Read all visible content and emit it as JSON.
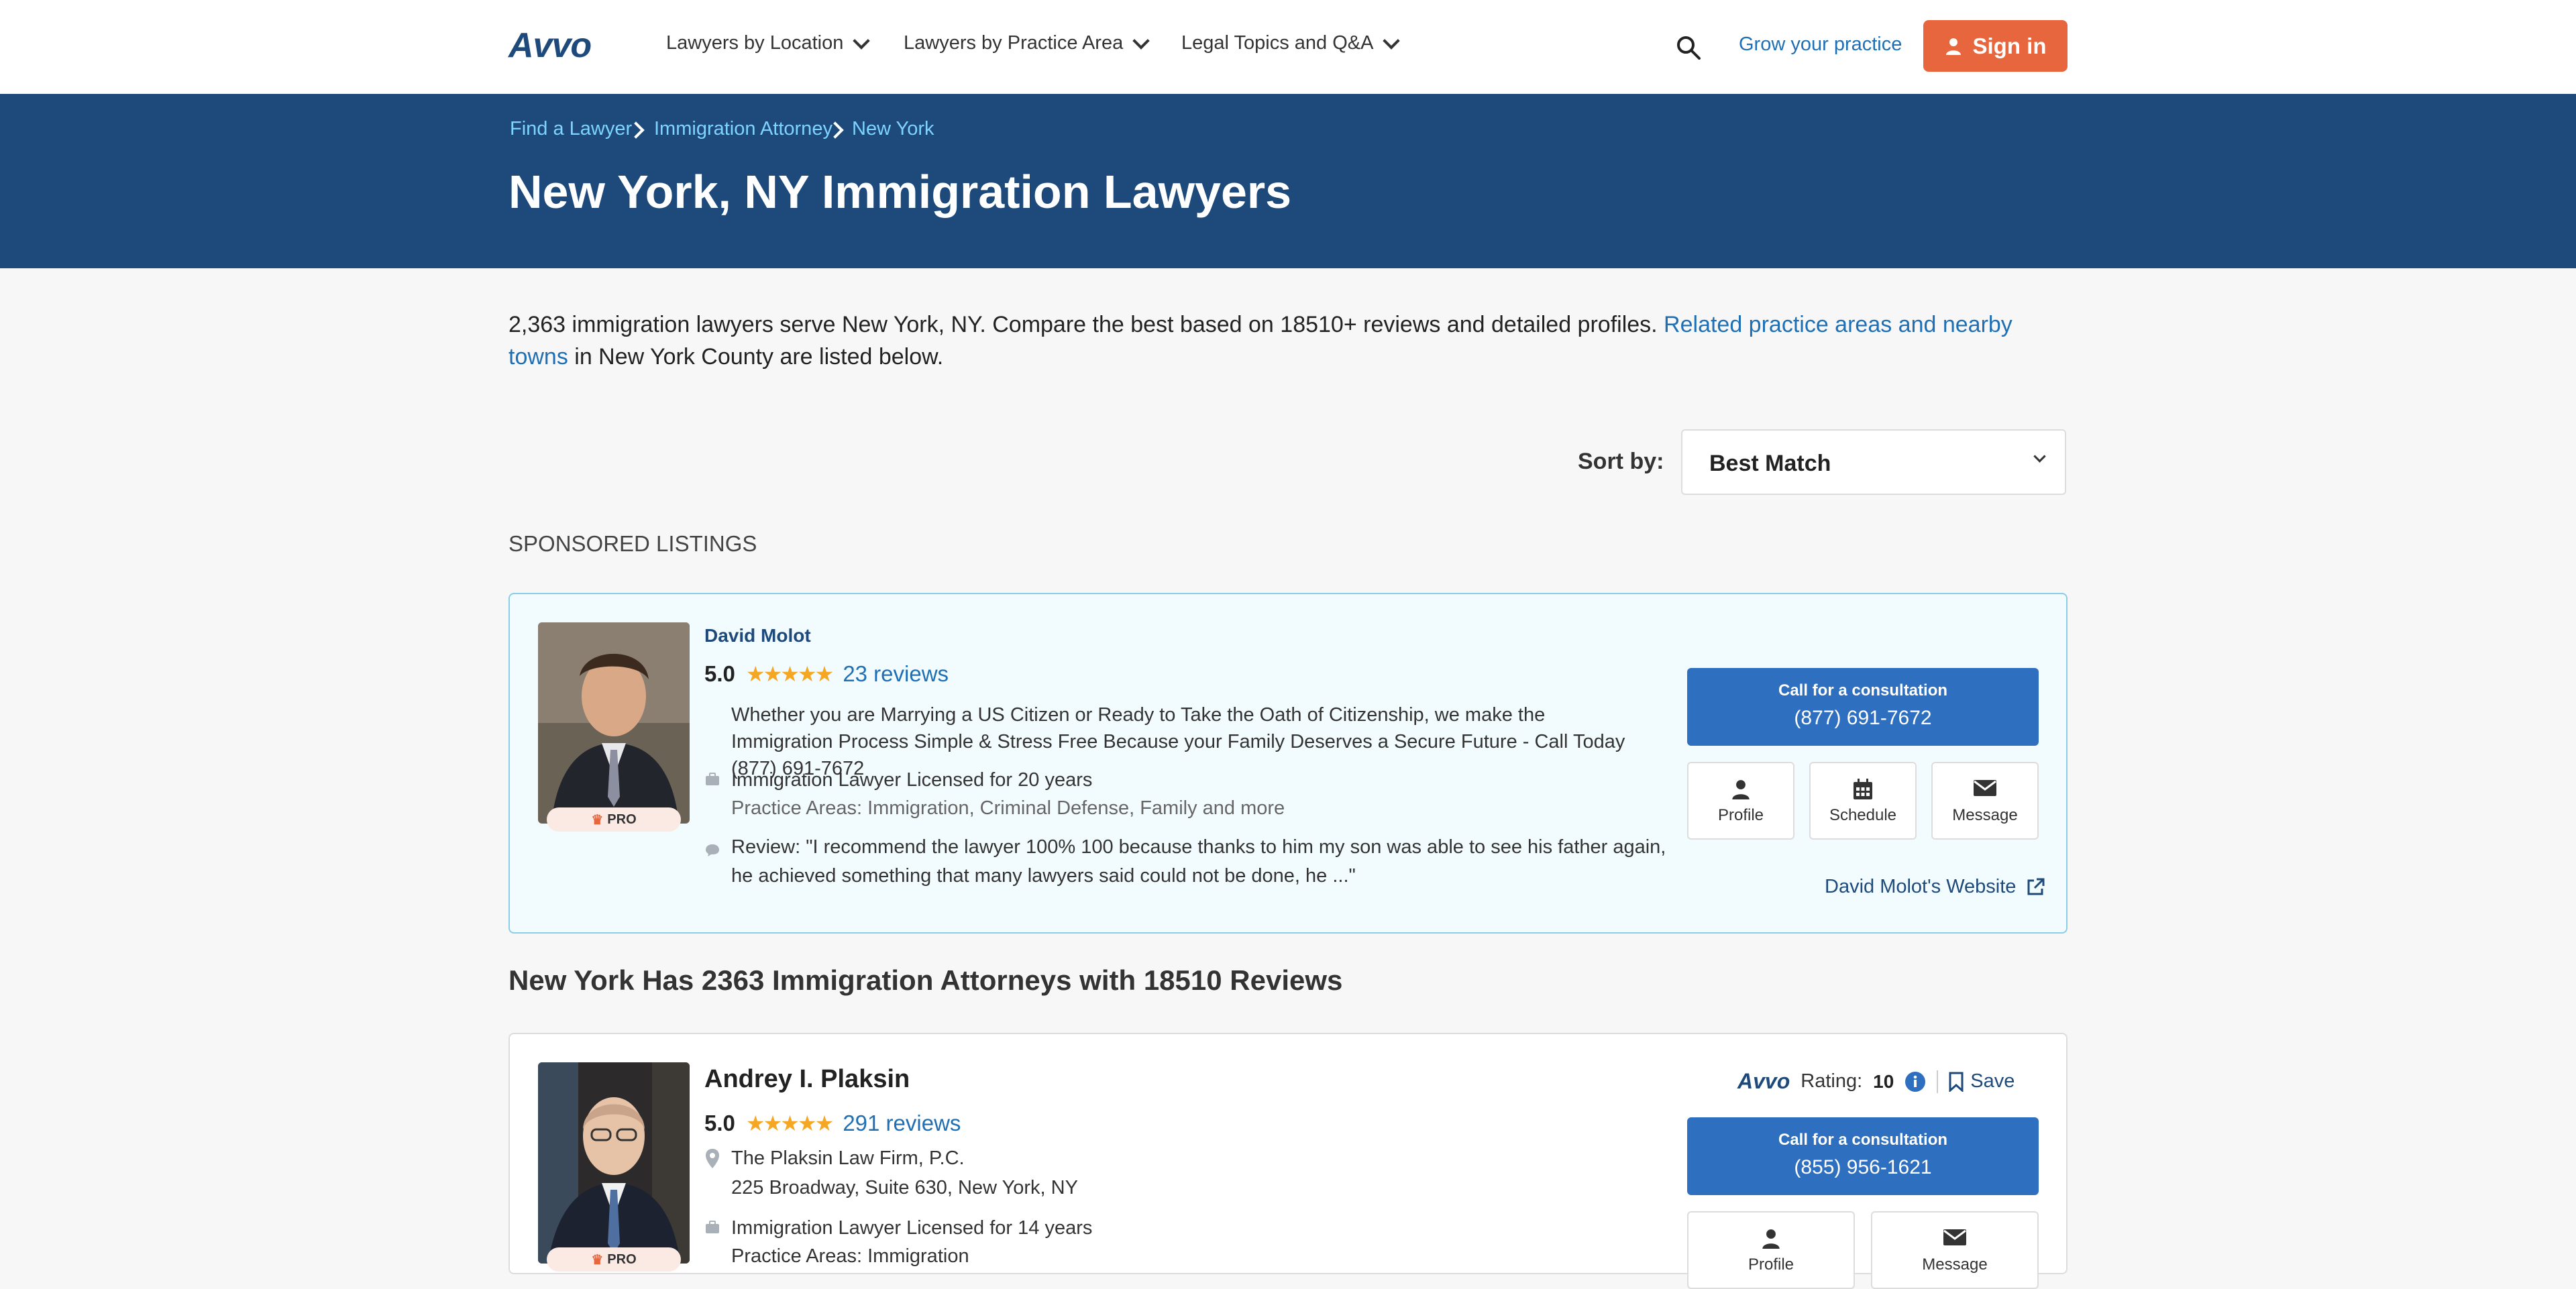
{
  "header": {
    "logo": "Avvo",
    "nav": [
      {
        "label": "Lawyers by Location"
      },
      {
        "label": "Lawyers by Practice Area"
      },
      {
        "label": "Legal Topics and Q&A"
      }
    ],
    "grow_label": "Grow your practice",
    "signin_label": "Sign in"
  },
  "breadcrumb": [
    "Find a Lawyer",
    "Immigration Attorney",
    "New York"
  ],
  "page_title": "New York, NY Immigration Lawyers",
  "intro": {
    "text_before": "2,363 immigration lawyers serve New York, NY. Compare the best based on 18510+ reviews and detailed profiles. ",
    "link": "Related practice areas and nearby towns",
    "text_after": " in New York County are listed below."
  },
  "sort": {
    "label": "Sort by:",
    "value": "Best Match"
  },
  "sponsored_heading": "SPONSORED LISTINGS",
  "sponsored_listing": {
    "name": "David Molot",
    "badge": "PRO",
    "score": "5.0",
    "stars": "★★★★★",
    "reviews": "23 reviews",
    "blurb": "Whether you are Marrying a US Citizen or Ready to Take the Oath of Citizenship, we make the Immigration Process Simple & Stress Free Because your Family Deserves a Secure Future - Call Today (877) 691-7672",
    "licensed": "Immigration Lawyer Licensed for 20 years",
    "practice_areas": "Practice Areas: Immigration, Criminal Defense, Family and more",
    "review": "Review: \"I recommend the lawyer 100% 100 because thanks to him my son was able to see his father again, he achieved something that many lawyers said could not be done, he ...\"",
    "call_label": "Call for a consultation",
    "phone": "(877) 691-7672",
    "buttons": [
      "Profile",
      "Schedule",
      "Message"
    ],
    "website": "David Molot's Website"
  },
  "results_heading": "New York Has 2363 Immigration Attorneys with 18510 Reviews",
  "listing": {
    "name": "Andrey I. Plaksin",
    "badge": "PRO",
    "score": "5.0",
    "stars": "★★★★★",
    "reviews": "291 reviews",
    "firm": "The Plaksin Law Firm, P.C.",
    "address": "225 Broadway, Suite 630, New York, NY",
    "licensed": "Immigration Lawyer Licensed for 14 years",
    "practice_areas": "Practice Areas:  Immigration",
    "avvo_label": "Avvo",
    "rating_label": "Rating:",
    "rating_value": "10",
    "save_label": "Save",
    "call_label": "Call for a consultation",
    "phone": "(855) 956-1621",
    "buttons": [
      "Profile",
      "Message"
    ]
  }
}
